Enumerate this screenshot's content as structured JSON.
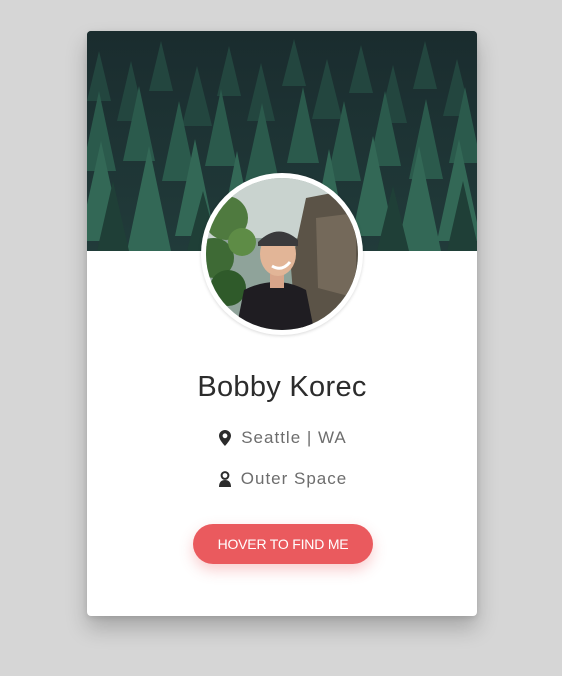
{
  "profile": {
    "name": "Bobby Korec",
    "location": "Seattle | WA",
    "planet": "Outer Space",
    "cta_label": "HOVER TO FIND ME"
  },
  "icons": {
    "location": "map-pin-icon",
    "planet": "user-badge-icon"
  },
  "colors": {
    "page_background": "#d6d6d6",
    "card_background": "#ffffff",
    "banner_forest": "#1c3233",
    "accent": "#ea5a5e",
    "name_text": "#2c2c2c",
    "info_text": "#6d6d6d"
  }
}
